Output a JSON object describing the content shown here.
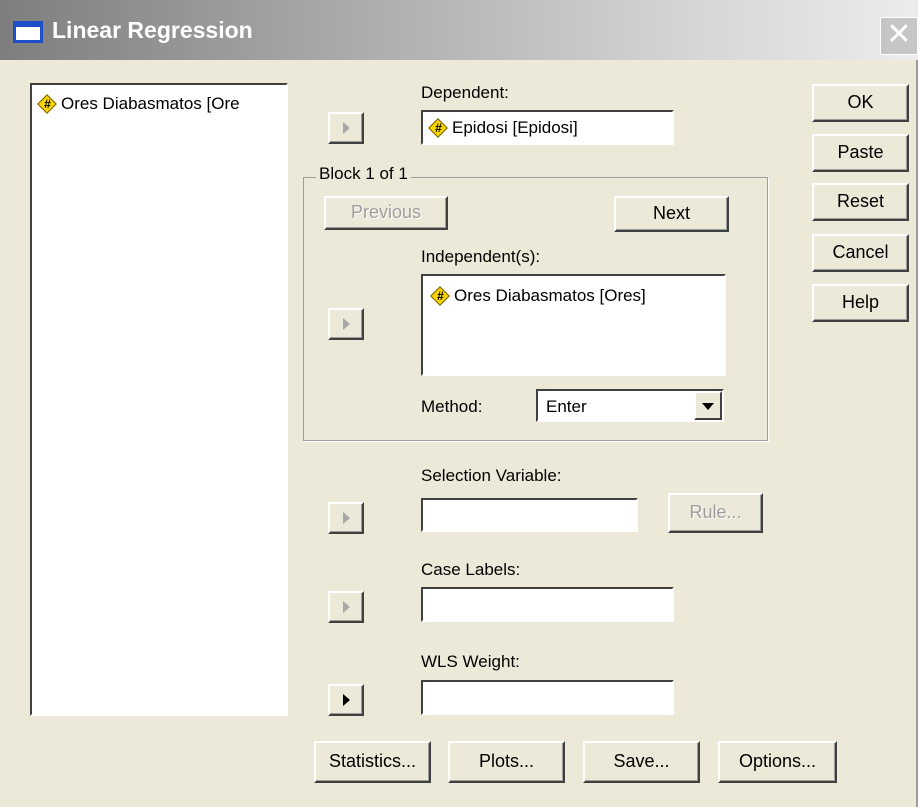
{
  "window": {
    "title": "Linear Regression",
    "close_glyph": "✕"
  },
  "variables": [
    {
      "name": "Ores Diabasmatos [Ore",
      "icon": "scale-variable-icon"
    }
  ],
  "dependent": {
    "label": "Dependent:",
    "value": "Epidosi [Epidosi]"
  },
  "block": {
    "label": "Block 1 of 1",
    "previous_label": "Previous",
    "next_label": "Next",
    "independents_label": "Independent(s):",
    "independents": [
      {
        "name": "Ores Diabasmatos [Ores]"
      }
    ],
    "method_label": "Method:",
    "method_value": "Enter"
  },
  "selection_variable": {
    "label": "Selection Variable:",
    "value": "",
    "rule_label": "Rule..."
  },
  "case_labels": {
    "label": "Case Labels:",
    "value": ""
  },
  "wls_weight": {
    "label": "WLS Weight:",
    "value": ""
  },
  "side_buttons": {
    "ok": "OK",
    "paste": "Paste",
    "reset": "Reset",
    "cancel": "Cancel",
    "help": "Help"
  },
  "bottom_buttons": {
    "statistics": "Statistics...",
    "plots": "Plots...",
    "save": "Save...",
    "options": "Options..."
  }
}
